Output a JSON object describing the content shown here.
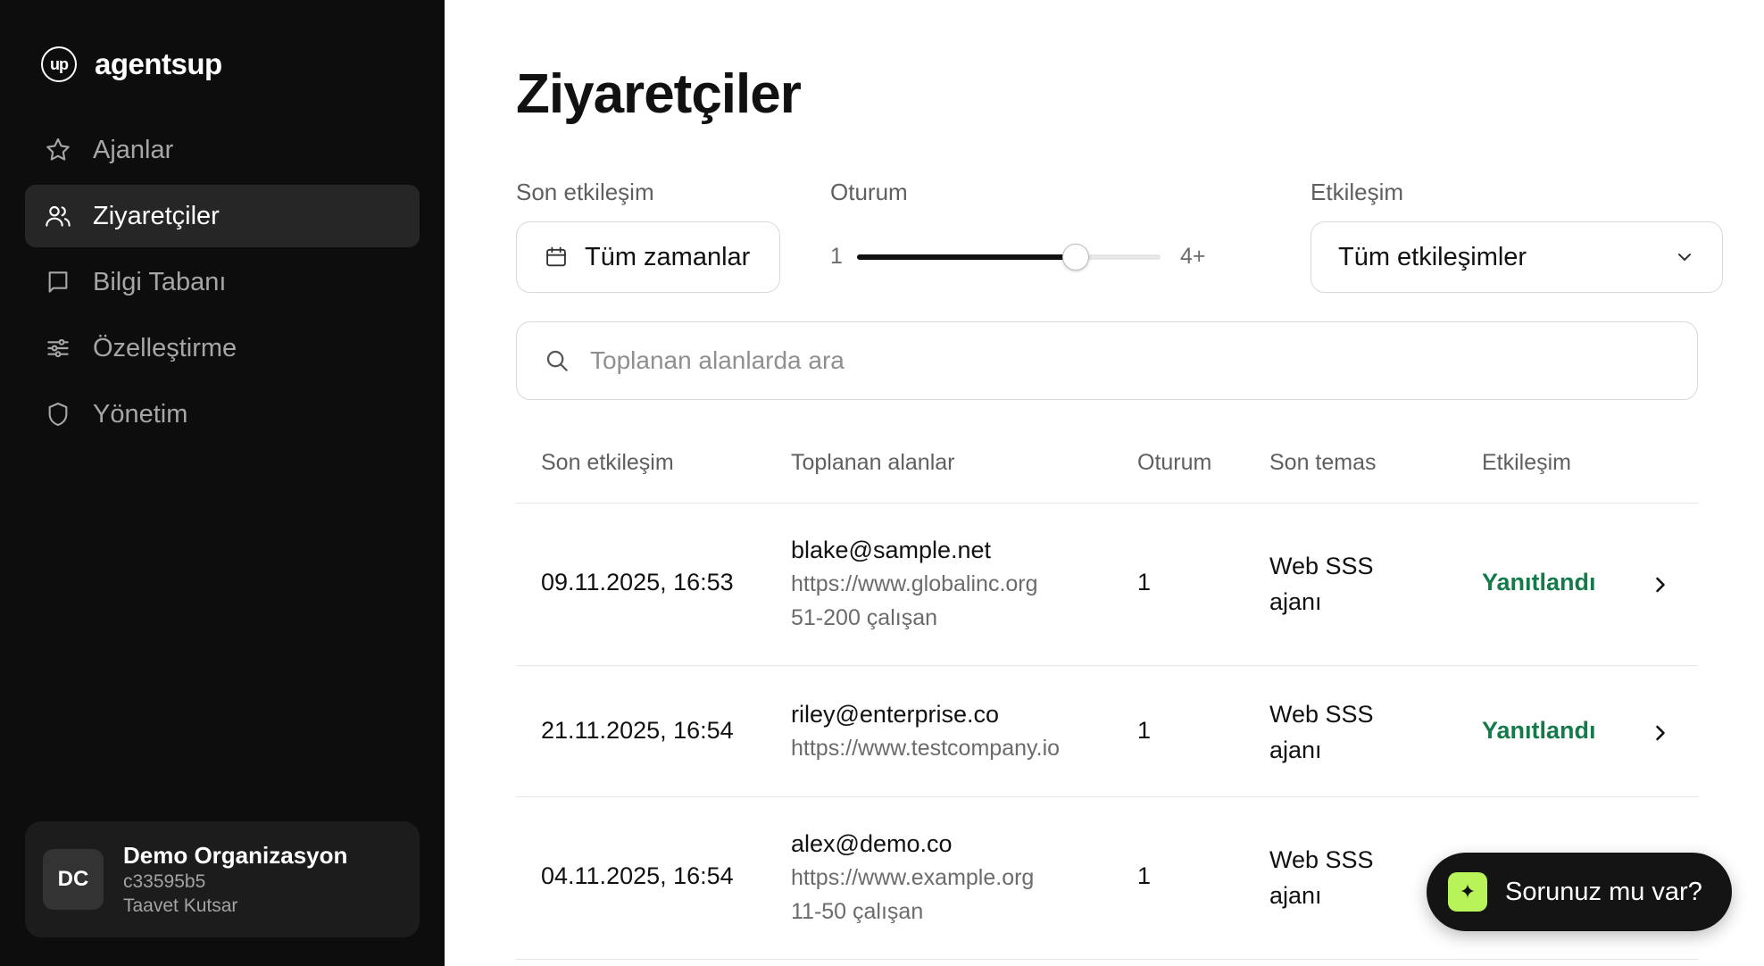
{
  "brand": {
    "logo_text": "up",
    "name": "agentsup"
  },
  "sidebar": {
    "items": [
      {
        "label": "Ajanlar",
        "icon": "star-icon",
        "active": false
      },
      {
        "label": "Ziyaretçiler",
        "icon": "users-icon",
        "active": true
      },
      {
        "label": "Bilgi Tabanı",
        "icon": "book-icon",
        "active": false
      },
      {
        "label": "Özelleştirme",
        "icon": "sliders-icon",
        "active": false
      },
      {
        "label": "Yönetim",
        "icon": "shield-icon",
        "active": false
      }
    ],
    "org": {
      "initials": "DC",
      "name": "Demo Organizasyon",
      "id": "c33595b5",
      "user": "Taavet Kutsar"
    }
  },
  "page": {
    "title": "Ziyaretçiler"
  },
  "filters": {
    "last_interaction": {
      "label": "Son etkileşim",
      "value": "Tüm zamanlar"
    },
    "session": {
      "label": "Oturum",
      "min": "1",
      "max": "4+",
      "level": 0.72
    },
    "interaction": {
      "label": "Etkileşim",
      "value": "Tüm etkileşimler"
    }
  },
  "search": {
    "placeholder": "Toplanan alanlarda ara"
  },
  "table": {
    "headers": [
      "Son etkileşim",
      "Toplanan alanlar",
      "Oturum",
      "Son temas",
      "Etkileşim"
    ],
    "rows": [
      {
        "date": "09.11.2025, 16:53",
        "email": "blake@sample.net",
        "url": "https://www.globalinc.org",
        "size": "51-200 çalışan",
        "sessions": "1",
        "contact_line1": "Web SSS",
        "contact_line2": "ajanı",
        "status": "Yanıtlandı"
      },
      {
        "date": "21.11.2025, 16:54",
        "email": "riley@enterprise.co",
        "url": "https://www.testcompany.io",
        "size": "",
        "sessions": "1",
        "contact_line1": "Web SSS",
        "contact_line2": "ajanı",
        "status": "Yanıtlandı"
      },
      {
        "date": "04.11.2025, 16:54",
        "email": "alex@demo.co",
        "url": "https://www.example.org",
        "size": "11-50 çalışan",
        "sessions": "1",
        "contact_line1": "Web SSS",
        "contact_line2": "ajanı",
        "status": ""
      }
    ]
  },
  "help": {
    "label": "Sorunuz mu var?",
    "icon": "sparkle-icon"
  },
  "colors": {
    "sidebar_bg": "#0d0d0d",
    "active_item": "#262626",
    "status_green": "#147a4a",
    "help_accent": "#b8f35a"
  }
}
